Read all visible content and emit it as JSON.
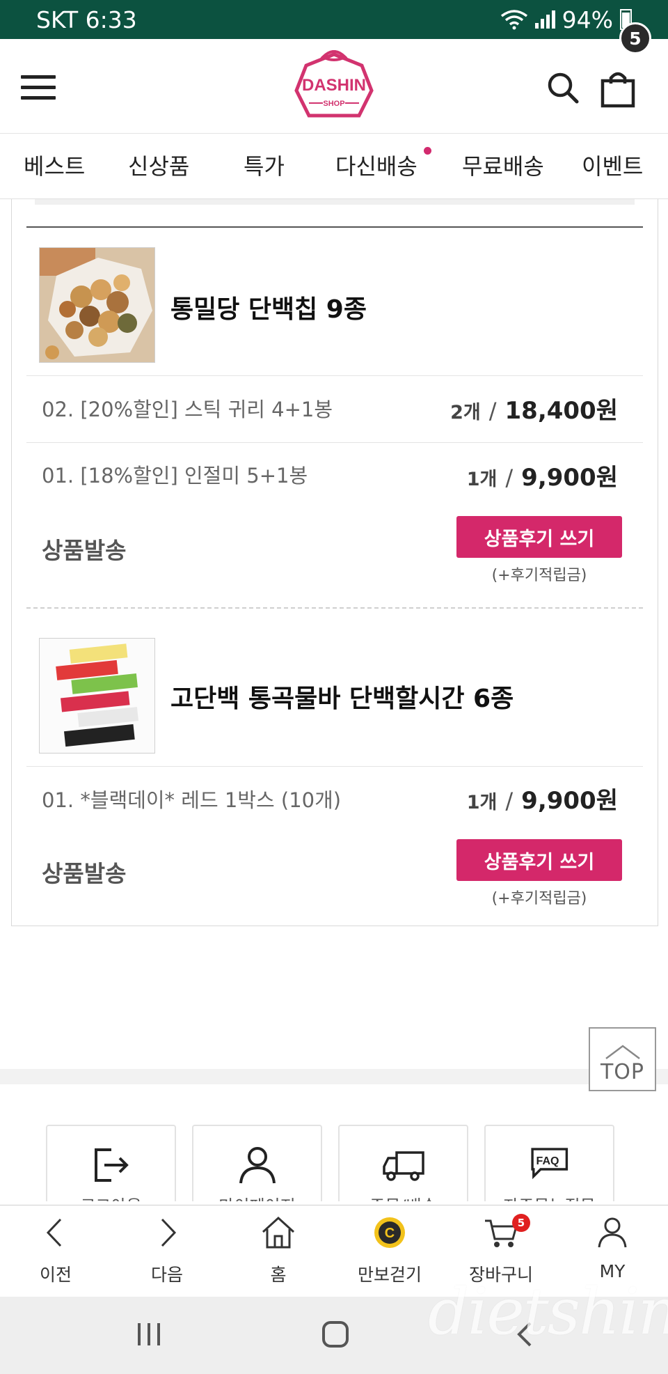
{
  "status_bar": {
    "carrier_time": "SKT 6:33",
    "battery": "94%"
  },
  "header": {
    "logo_text": "DASHIN",
    "logo_sub": "SHOP",
    "cart_count": "5"
  },
  "tabs": [
    "베스트",
    "신상품",
    "특가",
    "다신배송",
    "무료배송",
    "이벤트"
  ],
  "orders": [
    {
      "name": "통밀당 단백칩 9종",
      "image": "bowl of protein chips",
      "options": [
        {
          "label": "02. [20%할인] 스틱 귀리 4+1봉",
          "qty": "2개",
          "price": "18,400원"
        },
        {
          "label": "01. [18%할인] 인절미 5+1봉",
          "qty": "1개",
          "price": "9,900원"
        }
      ],
      "status": "상품발송",
      "review_button": "상품후기 쓰기",
      "review_note": "(+후기적립금)"
    },
    {
      "name": "고단백 통곡물바 단백할시간 6종",
      "image": "protein bars",
      "options": [
        {
          "label": "01. *블랙데이* 레드 1박스 (10개)",
          "qty": "1개",
          "price": "9,900원"
        }
      ],
      "status": "상품발송",
      "review_button": "상품후기 쓰기",
      "review_note": "(+후기적립금)"
    }
  ],
  "top_button": "TOP",
  "quick_links": [
    {
      "label": "로그아웃",
      "icon": "logout-icon"
    },
    {
      "label": "마이페이지",
      "icon": "person-icon"
    },
    {
      "label": "주문/배송",
      "icon": "truck-icon"
    },
    {
      "label": "자주묻는질문",
      "icon": "faq-icon"
    }
  ],
  "faq_icon_text": "FAQ",
  "bottom_nav": [
    {
      "label": "이전",
      "icon": "back-icon"
    },
    {
      "label": "다음",
      "icon": "forward-icon"
    },
    {
      "label": "홈",
      "icon": "home-icon"
    },
    {
      "label": "만보걷기",
      "icon": "coin-icon"
    },
    {
      "label": "장바구니",
      "icon": "cart-icon",
      "badge": "5"
    },
    {
      "label": "MY",
      "icon": "user-icon"
    }
  ],
  "coin_letter": "C",
  "watermark": "dietshin.com",
  "colors": {
    "status_bar": "#0c5240",
    "accent": "#d4286a",
    "logo": "#d2336f"
  }
}
